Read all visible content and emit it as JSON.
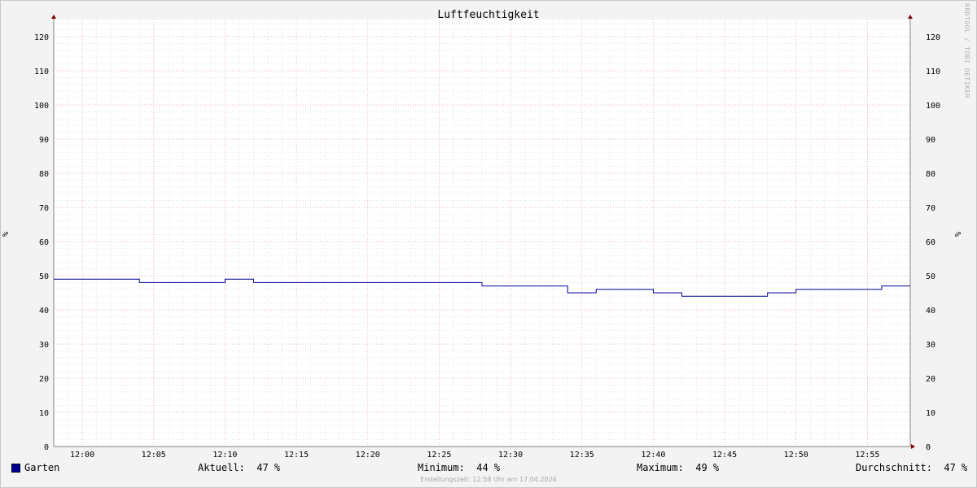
{
  "colors": {
    "background": "#f3f3f3",
    "plot_background": "#ffffff",
    "major_grid": "#e8a0a0",
    "minor_grid": "#d8d8d8",
    "series": "#000099",
    "axis_arrow": "#800000"
  },
  "chart_data": {
    "type": "line",
    "title": "Luftfeuchtigkeit",
    "ylabel": "%",
    "ylim": [
      0,
      125
    ],
    "yticks": [
      0,
      10,
      20,
      30,
      40,
      50,
      60,
      70,
      80,
      90,
      100,
      110,
      120
    ],
    "xlim": [
      "11:58",
      "12:58"
    ],
    "xticks": [
      "12:00",
      "12:05",
      "12:10",
      "12:15",
      "12:20",
      "12:25",
      "12:30",
      "12:35",
      "12:40",
      "12:45",
      "12:50",
      "12:55"
    ],
    "grid": true,
    "series": [
      {
        "name": "Garten",
        "color": "#000099",
        "points": [
          [
            "11:58",
            49
          ],
          [
            "12:04",
            48
          ],
          [
            "12:10",
            49
          ],
          [
            "12:12",
            48
          ],
          [
            "12:28",
            47
          ],
          [
            "12:34",
            45
          ],
          [
            "12:36",
            46
          ],
          [
            "12:40",
            45
          ],
          [
            "12:42",
            44
          ],
          [
            "12:48",
            45
          ],
          [
            "12:50",
            46
          ],
          [
            "12:56",
            47
          ],
          [
            "12:58",
            47
          ]
        ]
      }
    ]
  },
  "legend": {
    "series_name": "Garten",
    "current": "Aktuell:  47 %",
    "minimum": "Minimum:  44 %",
    "maximum": "Maximum:  49 %",
    "average": "Durchschnitt:  47 %"
  },
  "watermark": "RRDTOOL / TOBI OETIKER",
  "footer": "Erstellungszeit: 12:58 Uhr am 17.04.2026"
}
